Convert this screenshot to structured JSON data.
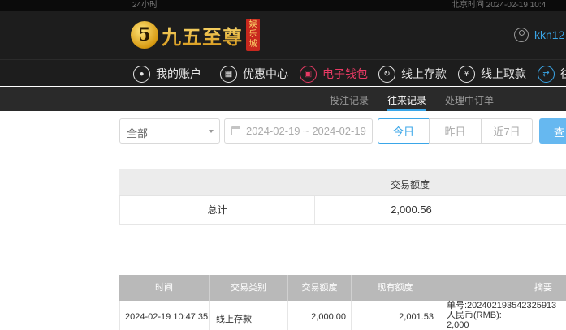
{
  "topbar": {
    "left_text": "24小时",
    "right_text": "北京时间 2024-02-19 10:4"
  },
  "header": {
    "logo_badge": "5",
    "logo_text": "九五至尊",
    "logo_seal": [
      "娱",
      "乐",
      "城"
    ],
    "username": "kkn12"
  },
  "nav": [
    {
      "label": "我的账户",
      "icon": "user-icon"
    },
    {
      "label": "优惠中心",
      "icon": "gift-icon"
    },
    {
      "label": "电子钱包",
      "icon": "wallet-icon",
      "active": true
    },
    {
      "label": "线上存款",
      "icon": "deposit-icon"
    },
    {
      "label": "线上取款",
      "icon": "withdraw-icon"
    },
    {
      "label": "往",
      "icon": "transfer-icon"
    }
  ],
  "subnav": [
    {
      "label": "投注记录"
    },
    {
      "label": "往来记录",
      "active": true
    },
    {
      "label": "处理中订单"
    }
  ],
  "filters": {
    "type_select": "全部",
    "date_range": "2024-02-19 ~ 2024-02-19",
    "quick": [
      "今日",
      "昨日",
      "近7日"
    ],
    "search_label": "查"
  },
  "summary": {
    "header": "交易额度",
    "row_label": "总计",
    "row_value": "2,000.56"
  },
  "detail": {
    "columns": [
      "时间",
      "交易类别",
      "交易额度",
      "现有额度",
      "摘要"
    ],
    "rows": [
      {
        "time": "2024-02-19 10:47:35",
        "category": "线上存款",
        "amount": "2,000.00",
        "balance": "2,001.53",
        "summary_lines": [
          "单号:202402193542325913",
          "人民币(RMB):",
          "2,000"
        ]
      }
    ]
  },
  "colors": {
    "accent_blue": "#3aa6e8",
    "active_pink": "#e83a64",
    "header_bg": "#1d1d1d"
  }
}
